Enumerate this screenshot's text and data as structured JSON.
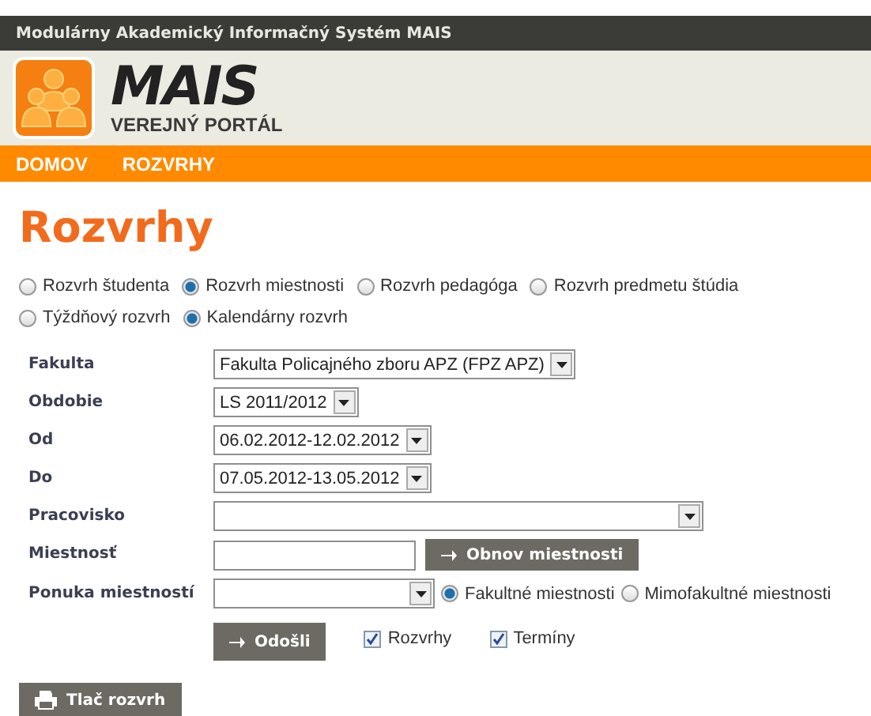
{
  "top_bar": {
    "title": "Modulárny Akademický Informačný Systém MAIS"
  },
  "header": {
    "logo": "MAIS",
    "subtitle": "VEREJNÝ PORTÁL"
  },
  "nav": [
    "DOMOV",
    "ROZVRHY"
  ],
  "page_title": "Rozvrhy",
  "schedule_types": [
    {
      "label": "Rozvrh študenta",
      "selected": false
    },
    {
      "label": "Rozvrh miestnosti",
      "selected": true
    },
    {
      "label": "Rozvrh pedagóga",
      "selected": false
    },
    {
      "label": "Rozvrh predmetu štúdia",
      "selected": false
    }
  ],
  "view_types": [
    {
      "label": "Týždňový rozvrh",
      "selected": false
    },
    {
      "label": "Kalendárny rozvrh",
      "selected": true
    }
  ],
  "form": [
    {
      "kind": "select",
      "label": "Fakulta",
      "value": "Fakulta Policajného zboru APZ (FPZ APZ)"
    },
    {
      "kind": "select",
      "label": "Obdobie",
      "value": "LS 2011/2012"
    },
    {
      "kind": "select",
      "label": "Od",
      "value": "06.02.2012-12.02.2012"
    },
    {
      "kind": "select",
      "label": "Do",
      "value": "07.05.2012-13.05.2012"
    },
    {
      "kind": "wide_select",
      "label": "Pracovisko"
    },
    {
      "kind": "input_button",
      "label": "Miestnosť",
      "button": "Obnov miestnosti"
    },
    {
      "kind": "select_radios",
      "label": "Ponuka miestností"
    }
  ],
  "room_scope": [
    {
      "label": "Fakultné miestnosti",
      "selected": true
    },
    {
      "label": "Mimofakultné miestnosti",
      "selected": false
    }
  ],
  "submit": "Odošli",
  "options": [
    {
      "label": "Rozvrhy",
      "checked": true
    },
    {
      "label": "Termíny",
      "checked": true
    }
  ],
  "print_button": "Tlač rozvrh"
}
